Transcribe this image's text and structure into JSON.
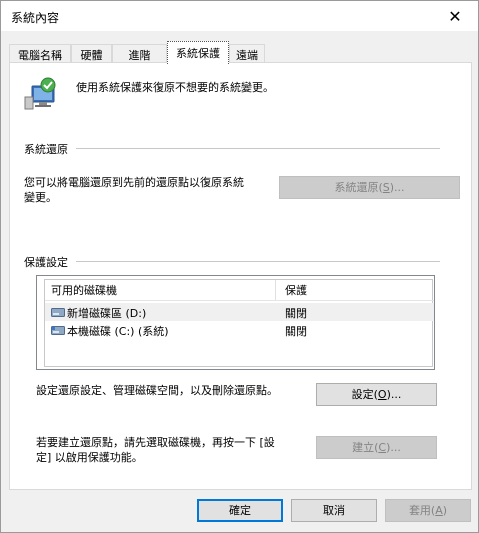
{
  "window": {
    "title": "系統內容"
  },
  "tabs": [
    {
      "label": "電腦名稱"
    },
    {
      "label": "硬體"
    },
    {
      "label": "進階"
    },
    {
      "label": "系統保護"
    },
    {
      "label": "遠端"
    }
  ],
  "intro": "使用系統保護來復原不想要的系統變更。",
  "restore_group": {
    "label": "系統還原",
    "description_line1": "您可以將電腦還原到先前的還原點以復原系統",
    "description_line2": "變更。",
    "button_text": "系統還原(",
    "button_key": "S",
    "button_suffix": ")..."
  },
  "protection_group": {
    "label": "保護設定",
    "columns": [
      "可用的磁碟機",
      "保護"
    ],
    "drives": [
      {
        "name": "新增磁碟區 (D:)",
        "status": "關閉"
      },
      {
        "name": "本機磁碟 (C:) (系統)",
        "status": "關閉"
      }
    ],
    "configure_text": "設定還原設定、管理磁碟空間，以及刪除還原點。",
    "configure_button": {
      "text": "設定(",
      "key": "O",
      "suffix": ")..."
    },
    "create_text_line1": "若要建立還原點，請先選取磁碟機，再按一下 [設",
    "create_text_line2": "定] 以啟用保護功能。",
    "create_button": {
      "text": "建立(",
      "key": "C",
      "suffix": ")..."
    }
  },
  "footer": {
    "ok": "確定",
    "cancel": "取消",
    "apply_text": "套用(",
    "apply_key": "A",
    "apply_suffix": ")"
  }
}
